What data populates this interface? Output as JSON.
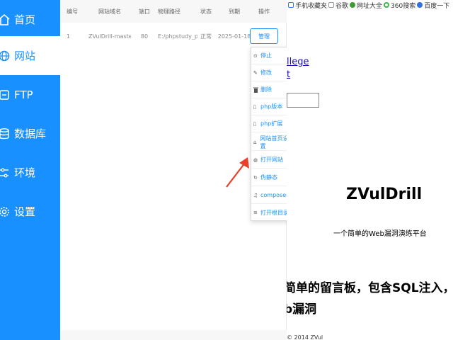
{
  "sidebar": {
    "items": [
      {
        "label": "首页",
        "icon": "home-icon"
      },
      {
        "label": "网站",
        "icon": "globe-icon",
        "active": true
      },
      {
        "label": "FTP",
        "icon": "ftp-icon"
      },
      {
        "label": "数据库",
        "icon": "database-icon"
      },
      {
        "label": "环境",
        "icon": "sliders-icon"
      },
      {
        "label": "设置",
        "icon": "gear-icon"
      }
    ],
    "colors": {
      "background": "#1890ff",
      "active_background": "#ffffff",
      "active_text": "#1890ff"
    }
  },
  "table": {
    "headers": [
      "编号",
      "网站域名",
      "端口",
      "物理路径",
      "状态",
      "到期",
      "操作"
    ],
    "rows": [
      {
        "id": "1",
        "domain": "ZVulDrill-master",
        "port": "80",
        "path": "E:/phpstudy_pr...",
        "status": "正常",
        "expire": "2025-01-18",
        "action": "管理"
      }
    ]
  },
  "menu": {
    "items": [
      {
        "label": "停止",
        "icon": "stop-icon",
        "submenu": false
      },
      {
        "label": "修改",
        "icon": "pencil-icon",
        "submenu": false
      },
      {
        "label": "删除",
        "icon": "trash-icon",
        "submenu": false
      },
      {
        "label": "php版本",
        "icon": "file-icon",
        "submenu": true
      },
      {
        "label": "php扩展",
        "icon": "file-icon",
        "submenu": true
      },
      {
        "label": "网站首页设置",
        "icon": "home-icon",
        "submenu": false
      },
      {
        "label": "打开网站",
        "icon": "globe-icon",
        "submenu": false
      },
      {
        "label": "伪静态",
        "icon": "refresh-icon",
        "submenu": false
      },
      {
        "label": "composer",
        "icon": "composer-icon",
        "submenu": false
      },
      {
        "label": "打开根目录",
        "icon": "list-icon",
        "submenu": false
      }
    ]
  },
  "browser": {
    "bookmarks": [
      {
        "label": "手机收藏夹",
        "icon": "mobile-icon"
      },
      {
        "label": "谷歌",
        "icon": "page-icon"
      },
      {
        "label": "网址大全",
        "icon": "star-icon"
      },
      {
        "label": "360搜索",
        "icon": "search-icon"
      },
      {
        "label": "百度一下",
        "icon": "paw-icon"
      }
    ],
    "link1": "llege",
    "link2": "t",
    "title": "ZVulDrill",
    "subtitle": "一个简单的Web漏洞演练平台",
    "description_line1": "简单的留言板，包含SQL注入，XSS，CSRF",
    "description_line2": "b漏洞",
    "copyright": "© 2014 ZVul"
  },
  "annotation": {
    "arrow_color": "#e8402a"
  }
}
